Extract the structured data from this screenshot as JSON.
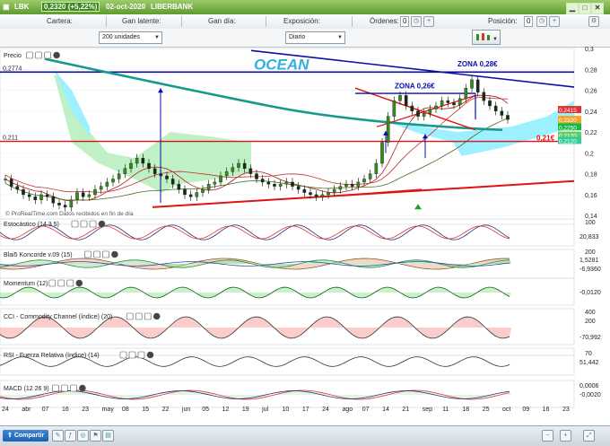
{
  "window": {
    "ticker": "LBK",
    "price_change": "0,2320 (+5,22%)",
    "date": "02-oct-2020",
    "name": "LIBERBANK"
  },
  "infobar": {
    "cartera": "Cartera:",
    "latente": "Gan latente:",
    "dia": "Gan día:",
    "exposicion": "Exposición:",
    "ordenes": "Órdenes:",
    "ordenes_val": "0",
    "posicion": "Posición:",
    "posicion_val": "0"
  },
  "toolbar": {
    "units": "200 unidades",
    "period": "Diario"
  },
  "bottom": {
    "share": "Compartir"
  },
  "colors": {
    "ichimoku_cloud_up": "#b9f0c0",
    "ichimoku_cloud_down": "#9df0ff",
    "sma_teal": "#159a8c",
    "resistance_blue": "#0b0ea8",
    "support_red": "#e01212",
    "candle_up": "#3a8a1a",
    "candle_down": "#1a2a1a"
  },
  "chart_data": [
    {
      "type": "candlestick",
      "panel": "Precio",
      "overlays": [
        "Ichimoku cloud",
        "SMA 200 (teal)",
        "Bollinger / moving averages"
      ],
      "annotations": {
        "brand": "OCEAN",
        "zona_028": "ZONA 0,28€",
        "zona_026": "ZONA 0,26€",
        "level_021": "0,21€",
        "level_2774": "0,2774",
        "level_211": "0,211",
        "watermark": "© ProRealTime.com  Datos recibidos en fin de día"
      },
      "ylim": [
        0.135,
        0.3
      ],
      "y_ticks": [
        "0,3",
        "0,28",
        "0,26",
        "0,24",
        "0,22",
        "0,2",
        "0,18",
        "0,16",
        "0,14"
      ],
      "price_labels": [
        "0,2415",
        "0,2320",
        "0,2250",
        "0,2170",
        "0,2120"
      ],
      "x_labels": [
        "24",
        "abr",
        "07",
        "16",
        "23",
        "may",
        "08",
        "15",
        "22",
        "jun",
        "05",
        "12",
        "19",
        "jul",
        "10",
        "17",
        "24",
        "ago",
        "07",
        "14",
        "21",
        "sep",
        "11",
        "18",
        "25",
        "oct",
        "09",
        "16",
        "23"
      ],
      "close_series": [
        0.175,
        0.168,
        0.165,
        0.16,
        0.158,
        0.155,
        0.16,
        0.158,
        0.152,
        0.15,
        0.148,
        0.155,
        0.162,
        0.158,
        0.16,
        0.165,
        0.168,
        0.172,
        0.175,
        0.18,
        0.185,
        0.19,
        0.195,
        0.19,
        0.185,
        0.18,
        0.178,
        0.175,
        0.17,
        0.165,
        0.16,
        0.158,
        0.162,
        0.165,
        0.17,
        0.172,
        0.178,
        0.182,
        0.186,
        0.19,
        0.185,
        0.18,
        0.175,
        0.172,
        0.17,
        0.168,
        0.17,
        0.172,
        0.168,
        0.165,
        0.162,
        0.16,
        0.158,
        0.16,
        0.162,
        0.165,
        0.168,
        0.17,
        0.168,
        0.172,
        0.175,
        0.18,
        0.19,
        0.21,
        0.235,
        0.25,
        0.255,
        0.245,
        0.24,
        0.235,
        0.238,
        0.242,
        0.245,
        0.25,
        0.248,
        0.246,
        0.252,
        0.262,
        0.27,
        0.258,
        0.25,
        0.245,
        0.24,
        0.236,
        0.232
      ],
      "level_lines": [
        0.2774,
        0.211,
        0.21
      ]
    },
    {
      "type": "line",
      "panel": "Estocástico (14 3 5)",
      "ylim": [
        0,
        100
      ],
      "last_label": "20,833",
      "y_ticks": [
        "100"
      ]
    },
    {
      "type": "area",
      "panel": "Blai5 Koncorde v.09 (15)",
      "last_labels": [
        "1,5281",
        "-6,9360"
      ],
      "y_ticks": [
        "200"
      ]
    },
    {
      "type": "line",
      "panel": "Momentum (12)",
      "last_label": "-0,0120"
    },
    {
      "type": "area",
      "panel": "CCI - Commodity Channel (índice) (20)",
      "ylim": [
        -200,
        400
      ],
      "last_label": "-70,992",
      "y_ticks": [
        "400",
        "200"
      ]
    },
    {
      "type": "line",
      "panel": "RSI - Fuerza Relativa (índice) (14)",
      "last_label": "51,442",
      "y_ticks": [
        "70"
      ]
    },
    {
      "type": "line",
      "panel": "MACD (12 26 9)",
      "last_labels": [
        "0,0006",
        "-0,0020"
      ]
    }
  ]
}
